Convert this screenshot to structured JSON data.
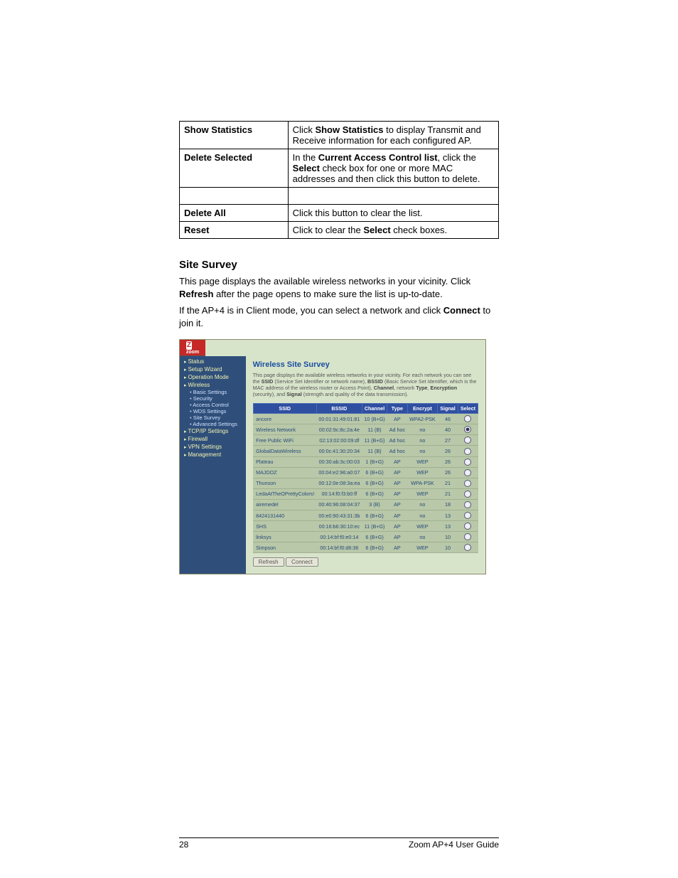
{
  "table_rows": [
    {
      "left": "Show Statistics",
      "right_pre": "Click ",
      "right_b": "Show Statistics",
      "right_post": " to display Transmit and Receive information for each configured AP."
    },
    {
      "left": "Delete Selected",
      "right_pre": "In the ",
      "right_b": "Current Access Control list",
      "right_mid": ", click the ",
      "right_b2": "Select",
      "right_post": " check box for one or more MAC addresses and then click this button to delete."
    },
    {
      "left": "Delete All",
      "right_pre": "Click this button to clear the list."
    },
    {
      "left": "Reset",
      "right_pre": "Click to clear the ",
      "right_b": "Select",
      "right_post": " check boxes."
    }
  ],
  "section_title": "Site Survey",
  "para1_pre": "This page displays the available wireless networks in your vicinity. Click ",
  "para1_b": "Refresh",
  "para1_post": " after the page opens to make sure the list is up-to-date.",
  "para2_pre": "If the AP+4 is in Client mode, you can select a network and click ",
  "para2_b": "Connect",
  "para2_post": " to join it.",
  "ss": {
    "logo_sub": "zoom",
    "nav": [
      {
        "t": "item tri",
        "l": "Status"
      },
      {
        "t": "item tri",
        "l": "Setup Wizard"
      },
      {
        "t": "item tri",
        "l": "Operation Mode"
      },
      {
        "t": "item tri",
        "l": "Wireless"
      },
      {
        "t": "sub",
        "l": "Basic Settings"
      },
      {
        "t": "sub",
        "l": "Security"
      },
      {
        "t": "sub",
        "l": "Access Control"
      },
      {
        "t": "sub",
        "l": "WDS Settings"
      },
      {
        "t": "sub",
        "l": "Site Survey"
      },
      {
        "t": "sub",
        "l": "Advanced Settings"
      },
      {
        "t": "item tri",
        "l": "TCP/IP Settings"
      },
      {
        "t": "item tri",
        "l": "Firewall"
      },
      {
        "t": "item tri",
        "l": "VPN Settings"
      },
      {
        "t": "item tri",
        "l": "Management"
      }
    ],
    "title": "Wireless Site Survey",
    "desc": "This page displays the available wireless networks in your vicinity. For each network you can see the SSID (Service Set Identifier or network name), BSSID (Basic Service Set Identifier, which is the MAC address of the wireless router or Access Point), Channel, network Type, Encryption (security), and Signal (strength and quality of the data transmission).",
    "cols": [
      "SSID",
      "BSSID",
      "Channel",
      "Type",
      "Encrypt",
      "Signal",
      "Select"
    ],
    "rows": [
      {
        "ssid": "ancore",
        "bssid": "00:01:31:49:01:81",
        "ch": "10 (B+G)",
        "type": "AP",
        "enc": "WPA2-PSK",
        "sig": "46",
        "sel": false
      },
      {
        "ssid": "Wireless Network",
        "bssid": "00:02:9c:8c:2a:4e",
        "ch": "11 (B)",
        "type": "Ad hoc",
        "enc": "no",
        "sig": "40",
        "sel": true
      },
      {
        "ssid": "Free Public WiFi",
        "bssid": "02:13:02:00:09:df",
        "ch": "11 (B+G)",
        "type": "Ad hoc",
        "enc": "no",
        "sig": "27",
        "sel": false
      },
      {
        "ssid": "GlobalDataWireless",
        "bssid": "00:0c:41:30:20:34",
        "ch": "11 (B)",
        "type": "Ad hoc",
        "enc": "no",
        "sig": "26",
        "sel": false
      },
      {
        "ssid": "Plateau",
        "bssid": "00:30:ab:3c:00:03",
        "ch": "1 (B+G)",
        "type": "AP",
        "enc": "WEP",
        "sig": "26",
        "sel": false
      },
      {
        "ssid": "MAJDOZ",
        "bssid": "00:04:e2:96:a0:07",
        "ch": "6 (B+G)",
        "type": "AP",
        "enc": "WEP",
        "sig": "26",
        "sel": false
      },
      {
        "ssid": "Thunson",
        "bssid": "00:12:0e:08:3a:ea",
        "ch": "6 (B+G)",
        "type": "AP",
        "enc": "WPA-PSK",
        "sig": "21",
        "sel": false
      },
      {
        "ssid": "LedaAtTheOPrettyColors!",
        "bssid": "00:14:f0:f3:b0:ff",
        "ch": "6 (B+G)",
        "type": "AP",
        "enc": "WEP",
        "sig": "21",
        "sel": false
      },
      {
        "ssid": "airemedel",
        "bssid": "00:40:96:08:04:37",
        "ch": "3 (B)",
        "type": "AP",
        "enc": "no",
        "sig": "18",
        "sel": false
      },
      {
        "ssid": "8424131440",
        "bssid": "00:e0:90:43:31:3b",
        "ch": "6 (B+G)",
        "type": "AP",
        "enc": "no",
        "sig": "13",
        "sel": false
      },
      {
        "ssid": "SHS",
        "bssid": "00:16:b6:30:10:ec",
        "ch": "11 (B+G)",
        "type": "AP",
        "enc": "WEP",
        "sig": "13",
        "sel": false
      },
      {
        "ssid": "linksys",
        "bssid": "00:14:bf:f0:e0:14",
        "ch": "6 (B+G)",
        "type": "AP",
        "enc": "no",
        "sig": "10",
        "sel": false
      },
      {
        "ssid": "Simpson",
        "bssid": "00:14:bf:f0:d6:36",
        "ch": "6 (B+G)",
        "type": "AP",
        "enc": "WEP",
        "sig": "10",
        "sel": false
      }
    ],
    "btn_refresh": "Refresh",
    "btn_connect": "Connect"
  },
  "footer_page": "28",
  "footer_right": "Zoom AP+4 User Guide"
}
